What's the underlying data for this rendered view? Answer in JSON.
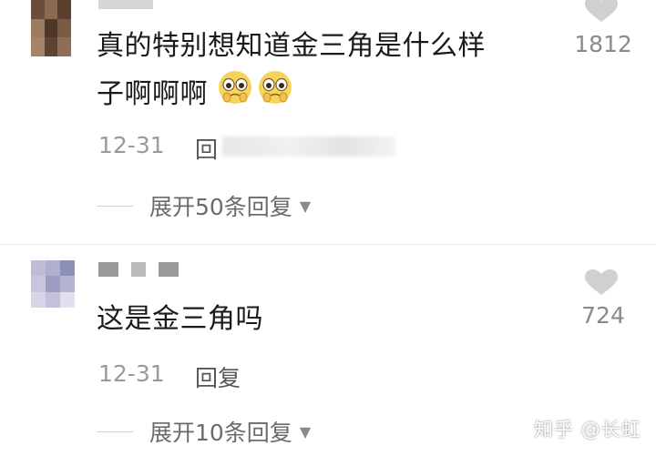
{
  "comments": [
    {
      "text_line1": "真的特别想知道金三角是什么样",
      "text_line2": "子啊啊啊",
      "likes": "1812",
      "date": "12-31",
      "reply_label": "回复",
      "expand_label": "展开50条回复"
    },
    {
      "text_line1": "这是金三角吗",
      "likes": "724",
      "date": "12-31",
      "reply_label": "回复",
      "expand_label": "展开10条回复"
    }
  ],
  "emojis": [
    "pleading-face",
    "pleading-face"
  ],
  "watermark": "知乎 @长虹"
}
